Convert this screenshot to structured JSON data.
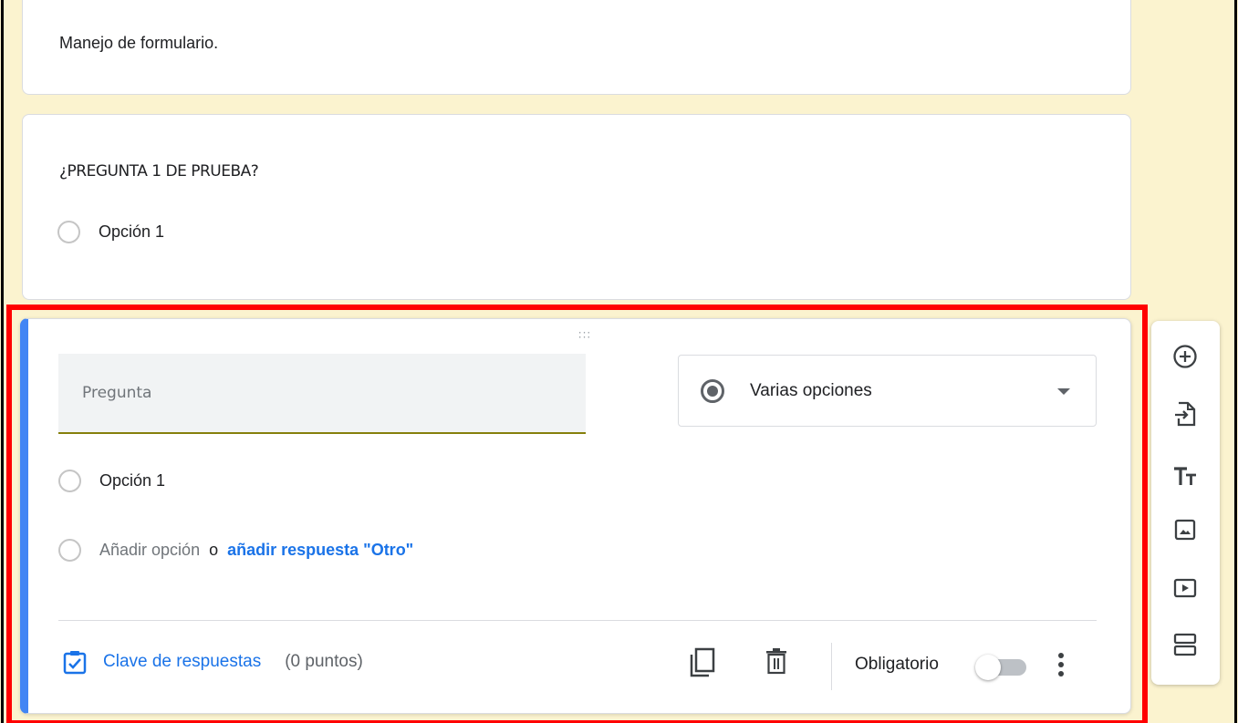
{
  "form": {
    "description": "Manejo de formulario.",
    "question1": {
      "title": "¿PREGUNTA 1 DE PRUEBA?",
      "option1": "Opción 1"
    },
    "editor": {
      "question_placeholder": "Pregunta",
      "type_label": "Varias opciones",
      "option1": "Opción 1",
      "add_option": "Añadir opción",
      "or": "o",
      "add_other": "añadir respuesta \"Otro\"",
      "answer_key": "Clave de respuestas",
      "points": "(0 puntos)",
      "required_label": "Obligatorio",
      "required": false
    }
  },
  "sidebar": {
    "items": [
      {
        "icon": "add-circle-icon"
      },
      {
        "icon": "import-icon"
      },
      {
        "icon": "title-icon"
      },
      {
        "icon": "image-icon"
      },
      {
        "icon": "video-icon"
      },
      {
        "icon": "section-icon"
      }
    ]
  },
  "colors": {
    "background": "#fbf3cf",
    "accent": "#4285f4",
    "link": "#1a73e8",
    "highlight": "#ff0000"
  }
}
